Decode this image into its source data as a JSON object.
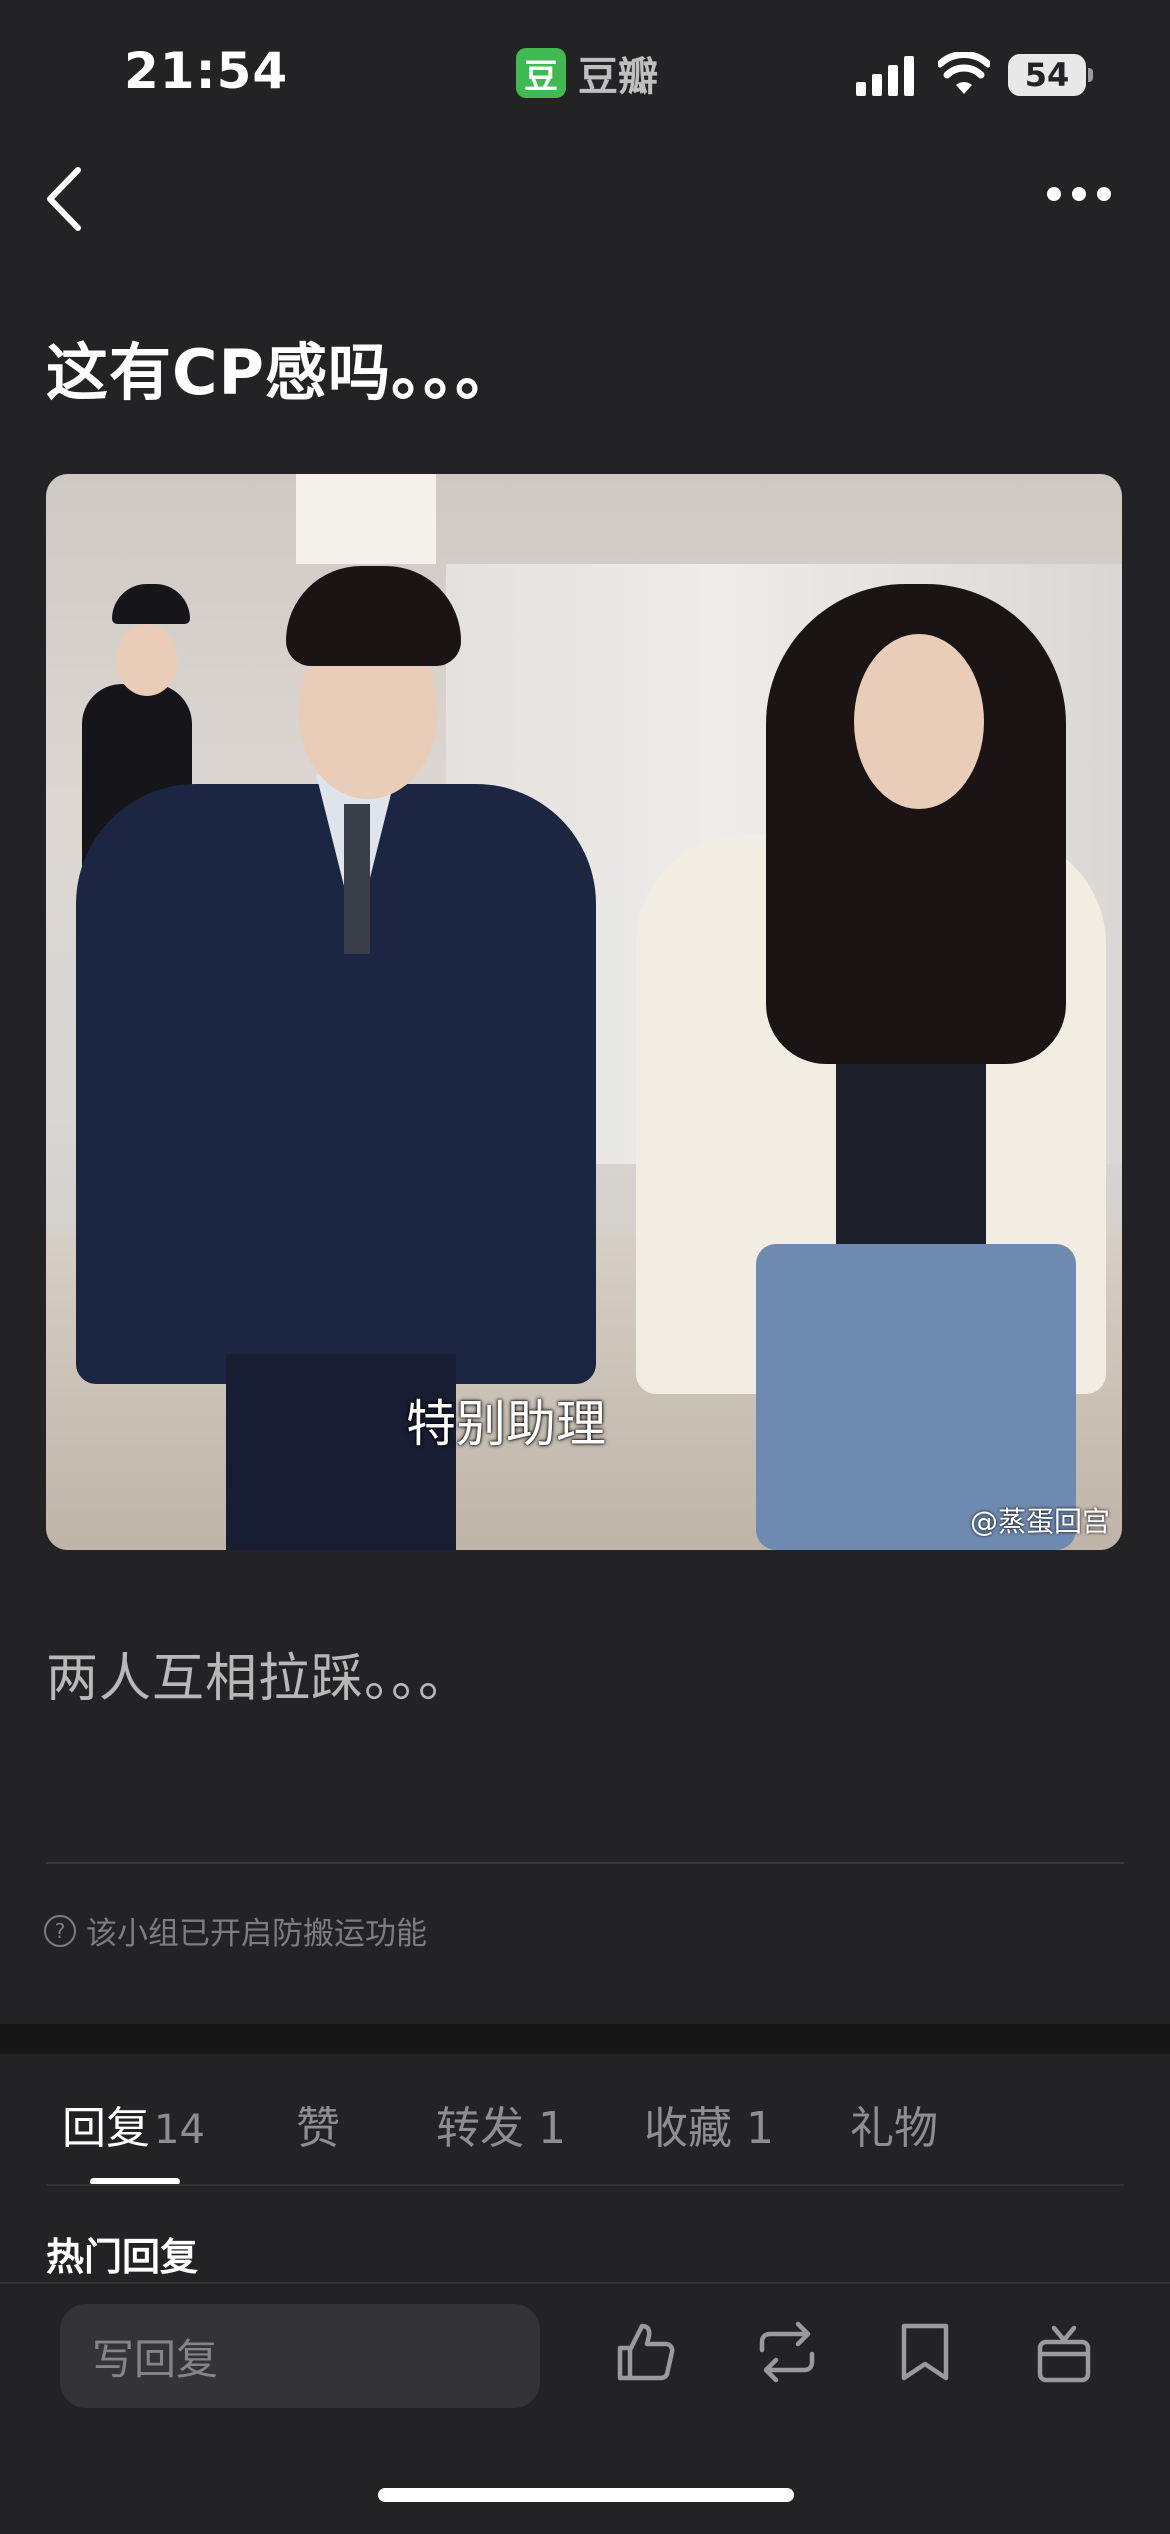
{
  "status_bar": {
    "time": "21:54",
    "battery": "54"
  },
  "app": {
    "logo_char": "豆",
    "name": "豆瓣"
  },
  "nav": {
    "back_icon": "back-chevron-icon",
    "more_icon": "more-dots-icon"
  },
  "post": {
    "title": "这有CP感吗。。。",
    "image_subtitle": "特别助理",
    "image_watermark": "@蒸蛋回宫",
    "body": "两人互相拉踩。。。",
    "notice": "该小组已开启防搬运功能",
    "notice_icon": "question-circle-icon"
  },
  "tabs": [
    {
      "label": "回复",
      "count": "14"
    },
    {
      "label": "赞"
    },
    {
      "label": "转发 1"
    },
    {
      "label": "收藏 1"
    },
    {
      "label": "礼物"
    }
  ],
  "section": {
    "hot_replies": "热门回复"
  },
  "bottom_bar": {
    "reply_placeholder": "写回复",
    "icons": [
      "thumbs-up-icon",
      "repost-icon",
      "bookmark-icon",
      "gift-icon"
    ]
  },
  "colors": {
    "background": "#232325",
    "brand_green": "#3fb950",
    "muted_text": "#8e8e90"
  }
}
